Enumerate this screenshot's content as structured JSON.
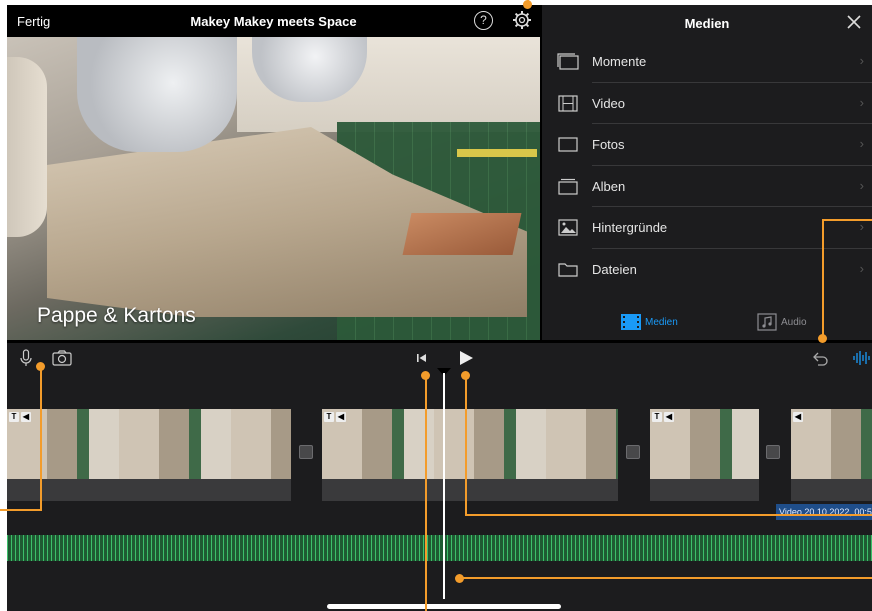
{
  "topbar": {
    "done_label": "Fertig",
    "project_title": "Makey Makey meets Space",
    "help_glyph": "?"
  },
  "preview": {
    "caption": "Pappe & Kartons"
  },
  "media_panel": {
    "title": "Medien",
    "items": [
      {
        "label": "Momente",
        "icon": "moments-icon"
      },
      {
        "label": "Video",
        "icon": "film-icon"
      },
      {
        "label": "Fotos",
        "icon": "photo-frame-icon"
      },
      {
        "label": "Alben",
        "icon": "album-icon"
      },
      {
        "label": "Hintergründe",
        "icon": "background-image-icon"
      },
      {
        "label": "Dateien",
        "icon": "folder-icon"
      }
    ],
    "chevron": "›",
    "tabs": {
      "media_label": "Medien",
      "audio_label": "Audio"
    }
  },
  "timeline": {
    "audio_clip_label": "Video 20.10.2022, 00:5"
  },
  "colors": {
    "accent_blue": "#1a9af7",
    "callout_orange": "#f39c2b",
    "audio_green": "#1f5a33",
    "panel_bg": "#1c1c1e"
  }
}
